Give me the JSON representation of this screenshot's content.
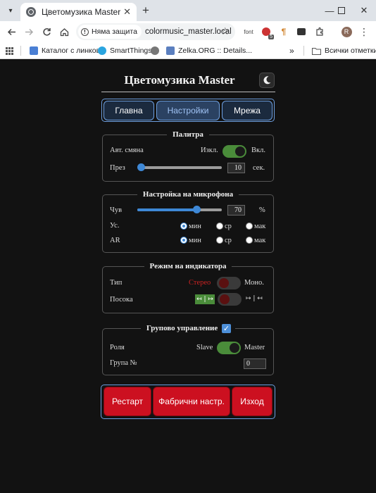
{
  "browser": {
    "tab_title": "Цветомузика Master",
    "security_label": "Няма защита",
    "url": "colormusic_master.local",
    "ext_font_label": "font",
    "ext_badge": "5",
    "profile_initial": "R"
  },
  "bookmarks": {
    "items": [
      {
        "label": "Каталог с линкове",
        "color": "#4a7fd4"
      },
      {
        "label": "SmartThings",
        "color": "#2aa5e0"
      },
      {
        "label": "Zelka.ORG :: Details...",
        "color": "#5b7fbf"
      }
    ],
    "more_label": "»",
    "all_label": "Всички отметки"
  },
  "app": {
    "title": "Цветомузика Master",
    "tabs": [
      {
        "label": "Главна"
      },
      {
        "label": "Настройки"
      },
      {
        "label": "Мрежа"
      }
    ],
    "active_tab": "Настройки"
  },
  "palette": {
    "legend": "Палитра",
    "auto_label": "Авт. смяна",
    "off_label": "Изкл.",
    "on_label": "Вкл.",
    "auto_on": true,
    "interval_label": "През",
    "interval_value": "10",
    "interval_fraction": 0.0,
    "interval_unit": "сек."
  },
  "mic": {
    "legend": "Настройка на микрофона",
    "sens_label": "Чув",
    "sens_value": "70",
    "sens_fraction": 0.7,
    "sens_unit": "%",
    "gain_label": "Ус.",
    "ar_label": "AR",
    "opt_min": "мин",
    "opt_mid": "ср",
    "opt_max": "мак",
    "gain_selected": "мин",
    "ar_selected": "мин"
  },
  "indicator": {
    "legend": "Режим на индикатора",
    "type_label": "Тип",
    "stereo_label": "Стерео",
    "mono_label": "Моно.",
    "type_on": false,
    "direction_label": "Посока",
    "dir_left_label": "↤ | ↦",
    "dir_right_label": "↦ | ↤",
    "direction_on": false,
    "stereo_color": "#cc2222"
  },
  "group": {
    "legend": "Групово управление",
    "enabled": true,
    "role_label": "Роля",
    "slave_label": "Slave",
    "master_label": "Master",
    "role_master": true,
    "group_no_label": "Група №",
    "group_no_value": "0"
  },
  "actions": {
    "restart_label": "Рестарт",
    "factory_label": "Фабрични настр.",
    "exit_label": "Изход"
  },
  "colors": {
    "accent_blue": "#3e88d6",
    "toggle_green": "#4a8c3a",
    "action_red": "#cc1020",
    "background": "#121212"
  }
}
